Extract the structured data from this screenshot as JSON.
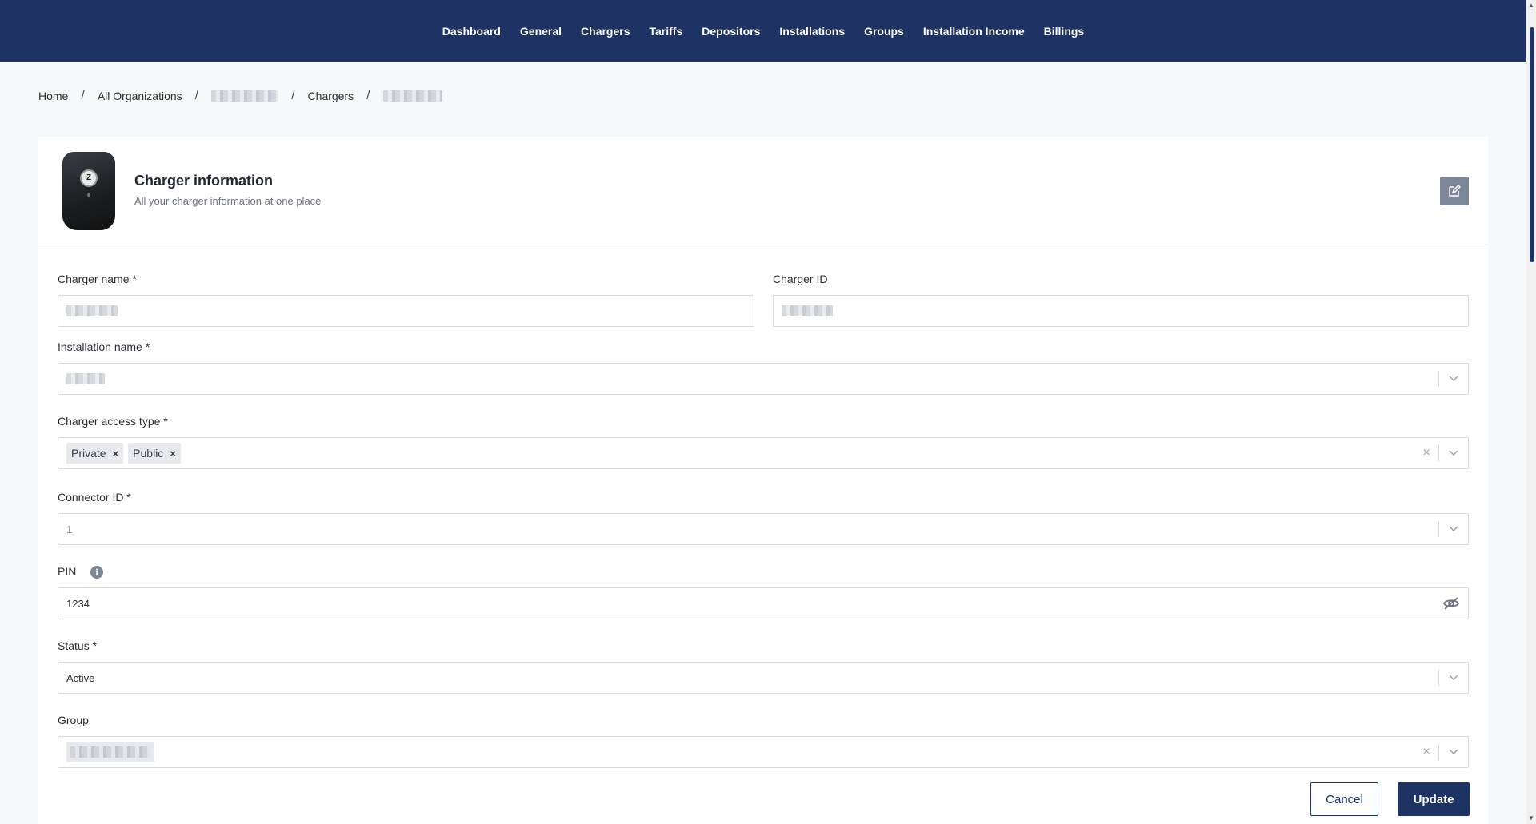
{
  "nav": {
    "items": [
      "Dashboard",
      "General",
      "Chargers",
      "Tariffs",
      "Depositors",
      "Installations",
      "Groups",
      "Installation Income",
      "Billings"
    ]
  },
  "breadcrumb": {
    "home": "Home",
    "organizations": "All Organizations",
    "chargers": "Chargers"
  },
  "card": {
    "title": "Charger information",
    "subtitle": "All your charger information at one place"
  },
  "form": {
    "charger_name_label": "Charger name *",
    "charger_id_label": "Charger ID",
    "installation_name_label": "Installation name *",
    "access_type_label": "Charger access type *",
    "access_types": [
      "Private",
      "Public"
    ],
    "connector_id_label": "Connector ID *",
    "connector_id_value": "1",
    "pin_label": "PIN",
    "pin_value": "1234",
    "status_label": "Status *",
    "status_value": "Active",
    "group_label": "Group"
  },
  "actions": {
    "cancel": "Cancel",
    "update": "Update"
  },
  "colors": {
    "primary": "#1e3363",
    "edit_button": "#7b8699"
  },
  "icons": {
    "edit": "edit-icon",
    "chevron": "chevron-down-icon",
    "clear": "clear-icon",
    "tag_remove": "close-icon",
    "info": "info-icon",
    "visibility": "eye-off-icon"
  }
}
